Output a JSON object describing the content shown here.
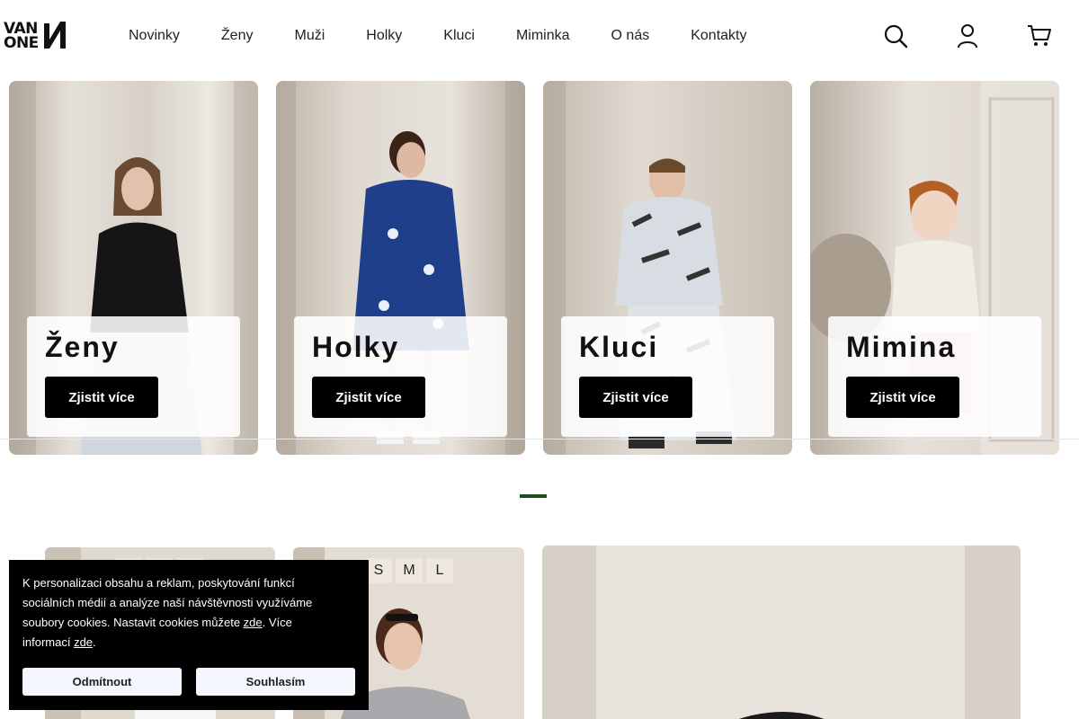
{
  "brand": {
    "logo_line1": "VAN",
    "logo_line2": "ONE",
    "logo_icon": "brand-mark-icon"
  },
  "nav": {
    "items": [
      {
        "label": "Novinky"
      },
      {
        "label": "Ženy"
      },
      {
        "label": "Muži"
      },
      {
        "label": "Holky"
      },
      {
        "label": "Kluci"
      },
      {
        "label": "Miminka"
      },
      {
        "label": "O nás"
      },
      {
        "label": "Kontakty"
      }
    ]
  },
  "header_icons": [
    "search-icon",
    "user-icon",
    "cart-icon"
  ],
  "categories": [
    {
      "title": "Ženy",
      "button": "Zjistit více"
    },
    {
      "title": "Holky",
      "button": "Zjistit více"
    },
    {
      "title": "Kluci",
      "button": "Zjistit více"
    },
    {
      "title": "Mimina",
      "button": "Zjistit více"
    }
  ],
  "products": {
    "sizes": [
      "S",
      "M",
      "L"
    ]
  },
  "cookie": {
    "text_part1": "K personalizaci obsahu a reklam, poskytování funkcí sociálních médií a analýze naší návštěvnosti využíváme soubory cookies. Nastavit cookies můžete ",
    "link1": "zde",
    "text_part2": ". Více informací ",
    "link2": "zde",
    "text_part3": ".",
    "decline": "Odmítnout",
    "accept": "Souhlasím"
  },
  "colors": {
    "accent": "#1a4d1a",
    "button_bg": "#000000",
    "cookie_bg": "#000000"
  }
}
